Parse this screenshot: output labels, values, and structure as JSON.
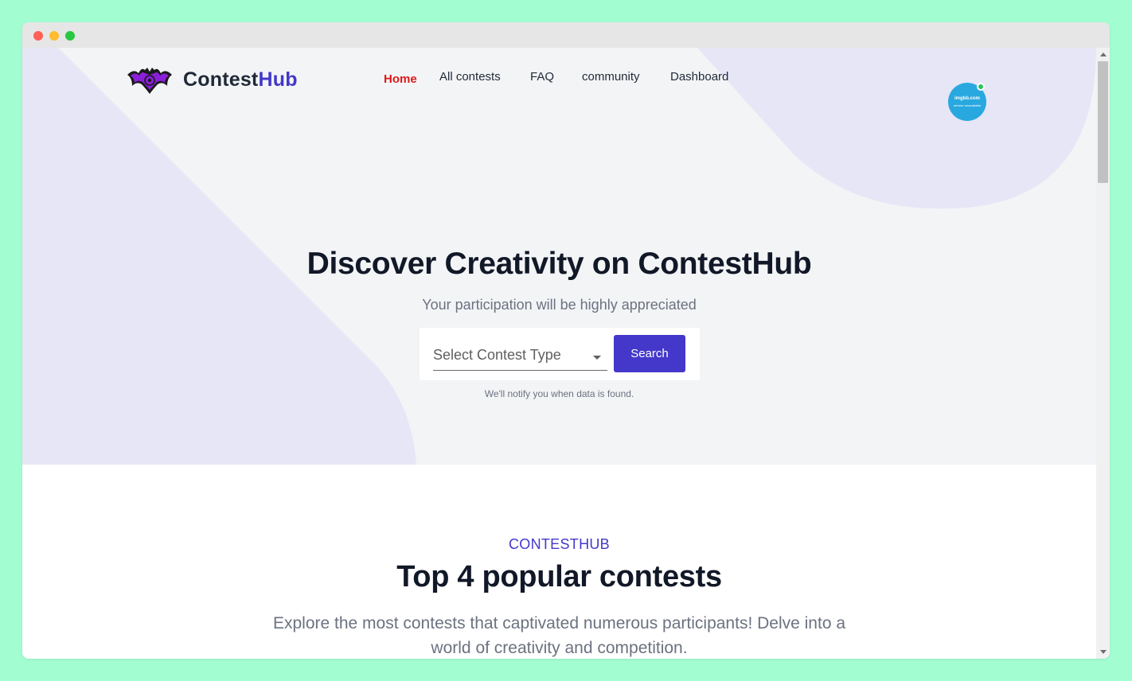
{
  "brand": {
    "name_main": "Contest",
    "name_accent": "Hub",
    "accent_color": "#4338ca",
    "logo_icon": "bat-logo-icon"
  },
  "nav": {
    "items": [
      {
        "label": "Home",
        "active": true
      },
      {
        "label": "All contests",
        "active": false
      },
      {
        "label": "FAQ",
        "active": false
      },
      {
        "label": "community",
        "active": false
      },
      {
        "label": "Dashboard",
        "active": false
      }
    ],
    "active_color": "#dc1a1a"
  },
  "avatar": {
    "line1": "imgbb.com",
    "line2": "service unavailable",
    "status": "online",
    "status_color": "#22c55e"
  },
  "hero": {
    "title": "Discover Creativity on ContestHub",
    "subtitle": "Your participation will be highly appreciated",
    "search": {
      "select_placeholder": "Select Contest Type",
      "button_label": "Search",
      "helper_text": "We'll notify you when data is found."
    }
  },
  "popular": {
    "kicker": "CONTESTHUB",
    "title": "Top 4 popular contests",
    "description": "Explore the most contests that captivated numerous participants! Delve into a world of creativity and competition."
  },
  "window": {
    "controls": [
      "close",
      "minimize",
      "maximize"
    ]
  }
}
